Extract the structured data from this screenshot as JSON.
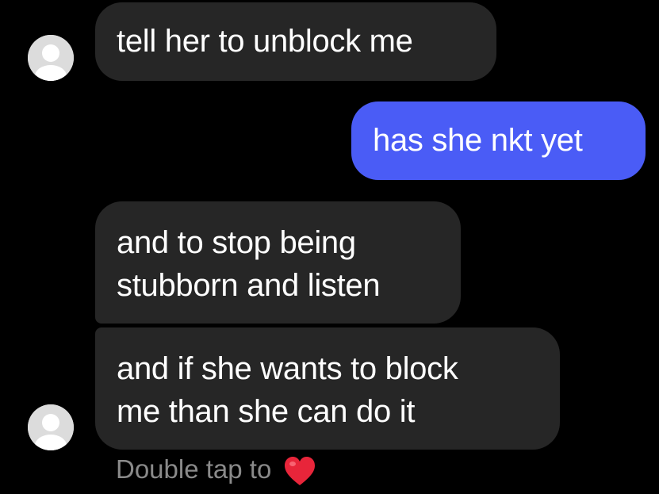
{
  "thread": {
    "messages": [
      {
        "sender": "other",
        "text": "tell her to unblock me"
      },
      {
        "sender": "me",
        "text": "has she nkt yet"
      },
      {
        "sender": "other",
        "text": "and to stop being\nstubborn and listen"
      },
      {
        "sender": "other",
        "text": "and if she wants to block\nme than she can do it"
      }
    ],
    "hint": "Double tap to",
    "hint_icon": "heart-icon"
  },
  "colors": {
    "background": "#000000",
    "incoming_bubble": "#262626",
    "outgoing_bubble": "#4a5cf6",
    "avatar": "#dcdcdc",
    "heart": "#e8253a"
  }
}
